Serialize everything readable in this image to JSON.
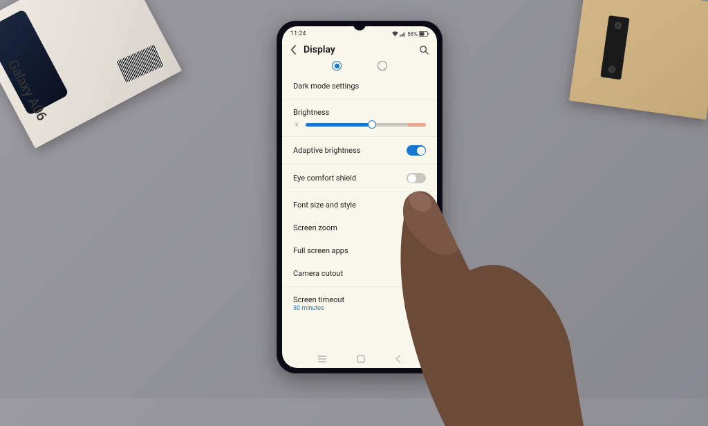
{
  "box": {
    "product": "Galaxy A06"
  },
  "status": {
    "time": "11:24",
    "battery": "58%"
  },
  "header": {
    "title": "Display"
  },
  "dark_mode": {
    "label": "Dark mode settings"
  },
  "brightness": {
    "label": "Brightness",
    "value_percent": 55
  },
  "adaptive": {
    "label": "Adaptive brightness",
    "enabled": true
  },
  "eye_comfort": {
    "label": "Eye comfort shield",
    "enabled": false
  },
  "items": {
    "font": "Font size and style",
    "zoom": "Screen zoom",
    "fullscreen": "Full screen apps",
    "cutout": "Camera cutout"
  },
  "timeout": {
    "label": "Screen timeout",
    "value": "30 minutes"
  }
}
